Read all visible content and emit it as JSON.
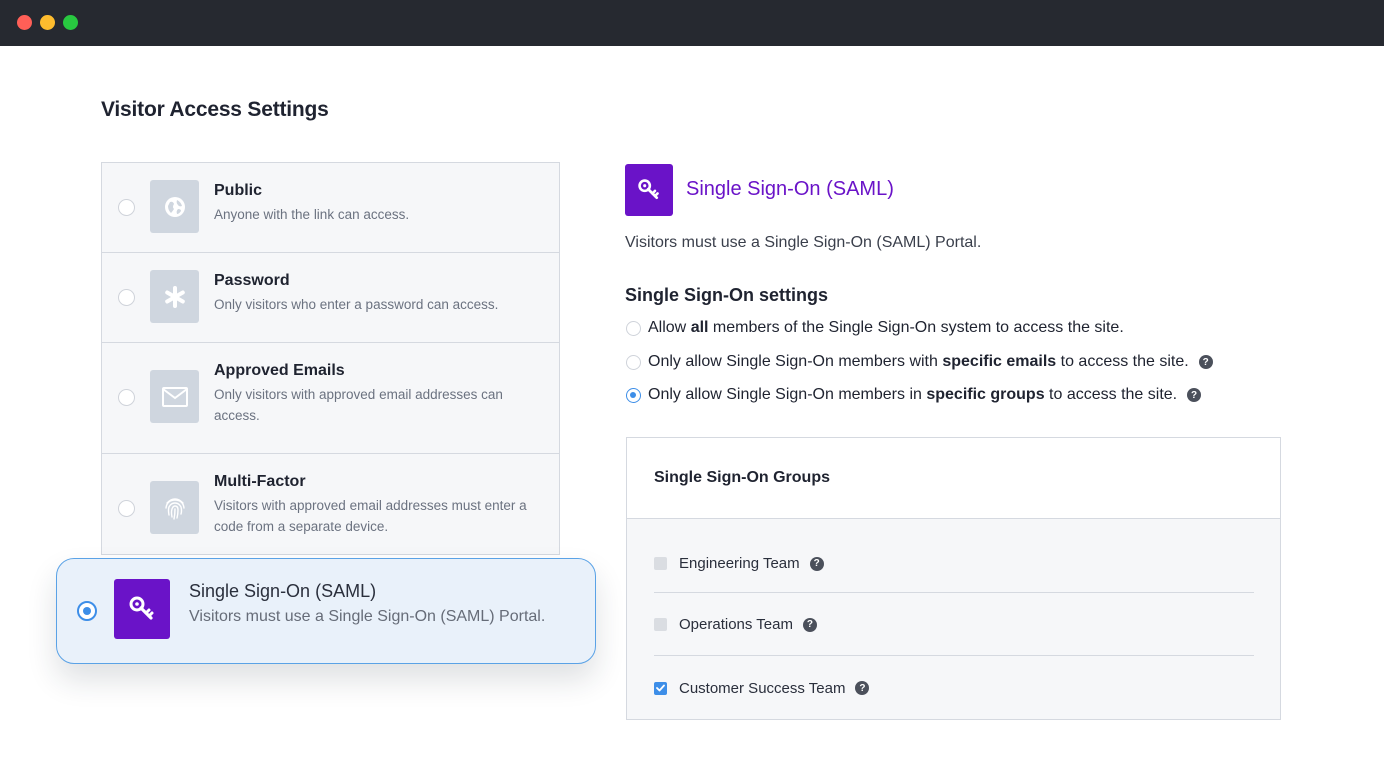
{
  "window": {
    "controls": [
      "close",
      "minimize",
      "maximize"
    ]
  },
  "page": {
    "title": "Visitor Access Settings"
  },
  "options": [
    {
      "title": "Public",
      "description": "Anyone with the link can access.",
      "icon": "globe-icon",
      "selected": false
    },
    {
      "title": "Password",
      "description": "Only visitors who enter a password can access.",
      "icon": "asterisk-icon",
      "selected": false
    },
    {
      "title": "Approved Emails",
      "description": "Only visitors with approved email addresses can access.",
      "icon": "envelope-icon",
      "selected": false
    },
    {
      "title": "Multi-Factor",
      "description": "Visitors with approved email addresses must enter a code from a separate device.",
      "icon": "fingerprint-icon",
      "selected": false
    },
    {
      "title": "Single Sign-On (SAML)",
      "description": "Visitors must use a Single Sign-On (SAML) Portal.",
      "icon": "key-icon",
      "selected": true
    }
  ],
  "detail": {
    "title": "Single Sign-On (SAML)",
    "description": "Visitors must use a Single Sign-On (SAML) Portal.",
    "settings_heading": "Single Sign-On settings",
    "settings": [
      {
        "prefix": "Allow ",
        "bold": "all",
        "suffix": " members of the Single Sign-On system to access the site.",
        "selected": false,
        "help": false
      },
      {
        "prefix": "Only allow Single Sign-On members with ",
        "bold": "specific emails",
        "suffix": " to access the site.",
        "selected": false,
        "help": true
      },
      {
        "prefix": "Only allow Single Sign-On members in ",
        "bold": "specific groups",
        "suffix": " to access the site.",
        "selected": true,
        "help": true
      }
    ],
    "groups_title": "Single Sign-On Groups",
    "groups": [
      {
        "name": "Engineering Team",
        "checked": false
      },
      {
        "name": "Operations Team",
        "checked": false
      },
      {
        "name": "Customer Success Team",
        "checked": true
      }
    ]
  },
  "colors": {
    "accent_purple": "#6a13c8",
    "accent_blue": "#3d8ee8",
    "titlebar": "#262930"
  }
}
